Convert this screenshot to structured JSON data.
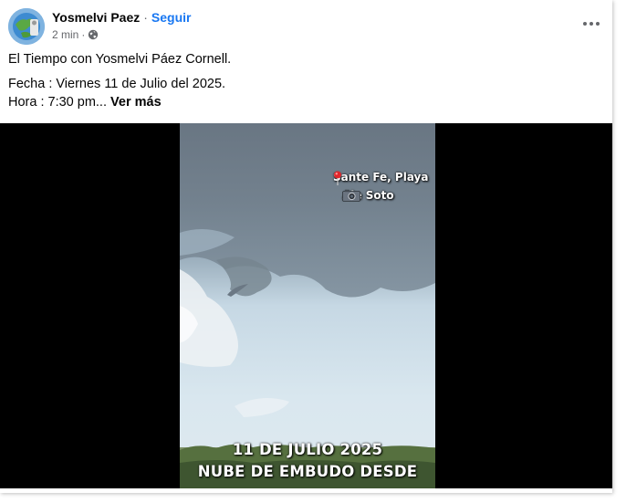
{
  "post": {
    "author": "Yosmelvi Paez",
    "separator": "·",
    "follow_label": "Seguir",
    "time": "2 min",
    "privacy_icon": "globe-icon",
    "text_line1": "El Tiempo con Yosmelvi Páez Cornell.",
    "text_line2": "Fecha :  Viernes 11 de Julio del 2025.",
    "text_line3": "Hora : 7:30 pm...",
    "see_more": "Ver más"
  },
  "video": {
    "location_label": "Sante Fe, Playa",
    "credit_label": "Ale Soto",
    "caption_line1": "11 DE JULIO 2025",
    "caption_line2": "NUBE DE EMBUDO DESDE"
  },
  "colors": {
    "link": "#1877f2",
    "secondary_text": "#65676b"
  }
}
